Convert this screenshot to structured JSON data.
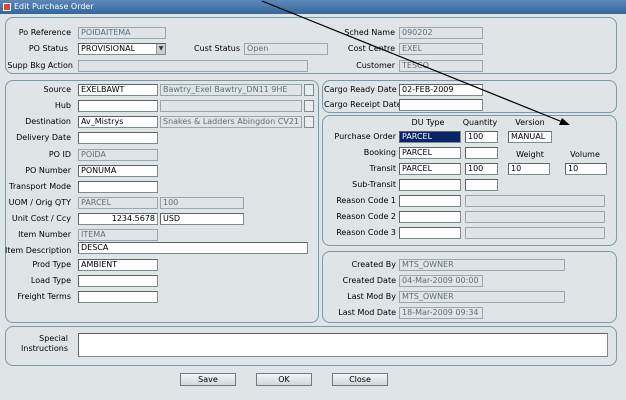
{
  "window": {
    "title": "Edit Purchase Order"
  },
  "header": {
    "po_reference_label": "Po Reference",
    "po_reference": "POIDAITEMA",
    "po_status_label": "PO Status",
    "po_status": "PROVISIONAL",
    "cust_status_label": "Cust Status",
    "cust_status": "Open",
    "supp_bkg_action_label": "Supp Bkg Action",
    "supp_bkg_action": "",
    "sched_name_label": "Sched Name",
    "sched_name": "090202",
    "cost_centre_label": "Cost Centre",
    "cost_centre": "EXEL",
    "customer_label": "Customer",
    "customer": "TESCO"
  },
  "left": {
    "source_label": "Source",
    "source_code": "EXELBAWT",
    "source_desc": "Bawtry_Exel Bawtry_DN11 9HE",
    "hub_label": "Hub",
    "hub_code": "",
    "hub_desc": "",
    "destination_label": "Destination",
    "destination_code": "Av_Mistrys",
    "destination_desc": "Snakes & Ladders Abingdon CV21",
    "delivery_date_label": "Delivery Date",
    "delivery_date": "",
    "po_id_label": "PO ID",
    "po_id": "POIDA",
    "po_number_label": "PO Number",
    "po_number": "PONUMA",
    "transport_mode_label": "Transport Mode",
    "transport_mode": "",
    "uom_label": "UOM / Orig QTY",
    "uom": "PARCEL",
    "orig_qty": "100",
    "unit_cost_label": "Unit Cost / Ccy",
    "unit_cost": "1234.5678",
    "ccy": "USD",
    "item_number_label": "Item Number",
    "item_number": "ITEMA",
    "item_description_label": "Item Description",
    "item_description": "DESCA",
    "prod_type_label": "Prod Type",
    "prod_type": "AMBIENT",
    "load_type_label": "Load Type",
    "load_type": "",
    "freight_terms_label": "Freight Terms",
    "freight_terms": ""
  },
  "cargo": {
    "ready_date_label": "Cargo Ready Date",
    "ready_date": "02-FEB-2009",
    "receipt_date_label": "Cargo Receipt Date",
    "receipt_date": ""
  },
  "units": {
    "du_type_header": "DU Type",
    "quantity_header": "Quantity",
    "version_header": "Version",
    "weight_header": "Weight",
    "volume_header": "Volume",
    "purchase_order_label": "Purchase Order",
    "purchase_order_du": "PARCEL",
    "purchase_order_qty": "100",
    "version": "MANUAL",
    "booking_label": "Booking",
    "booking_du": "PARCEL",
    "booking_qty": "",
    "transit_label": "Transit",
    "transit_du": "PARCEL",
    "transit_qty": "100",
    "transit_weight": "10",
    "transit_volume": "10",
    "sub_transit_label": "Sub-Transit",
    "sub_transit_du": "",
    "sub_transit_qty": "",
    "reason_code_1_label": "Reason Code 1",
    "reason_code_1": "",
    "reason_code_1_desc": "",
    "reason_code_2_label": "Reason Code 2",
    "reason_code_2": "",
    "reason_code_2_desc": "",
    "reason_code_3_label": "Reason Code 3",
    "reason_code_3": "",
    "reason_code_3_desc": ""
  },
  "audit": {
    "created_by_label": "Created By",
    "created_by": "MTS_OWNER",
    "created_date_label": "Created Date",
    "created_date": "04-Mar-2009 00:00",
    "last_mod_by_label": "Last Mod By",
    "last_mod_by": "MTS_OWNER",
    "last_mod_date_label": "Last Mod Date",
    "last_mod_date": "18-Mar-2009 09:34"
  },
  "instructions": {
    "label_line1": "Special",
    "label_line2": "Instructions",
    "value": ""
  },
  "buttons": {
    "save": "Save",
    "ok": "OK",
    "close": "Close"
  },
  "colors": {
    "titlebar": "#33669a",
    "panel_border": "#7a9aa8",
    "background": "#dfe5e7",
    "selection": "#0a246a"
  },
  "icons": {
    "window_icon": "form-icon",
    "dropdown": "chevron-down-icon",
    "lov": "list-of-values-icon"
  }
}
